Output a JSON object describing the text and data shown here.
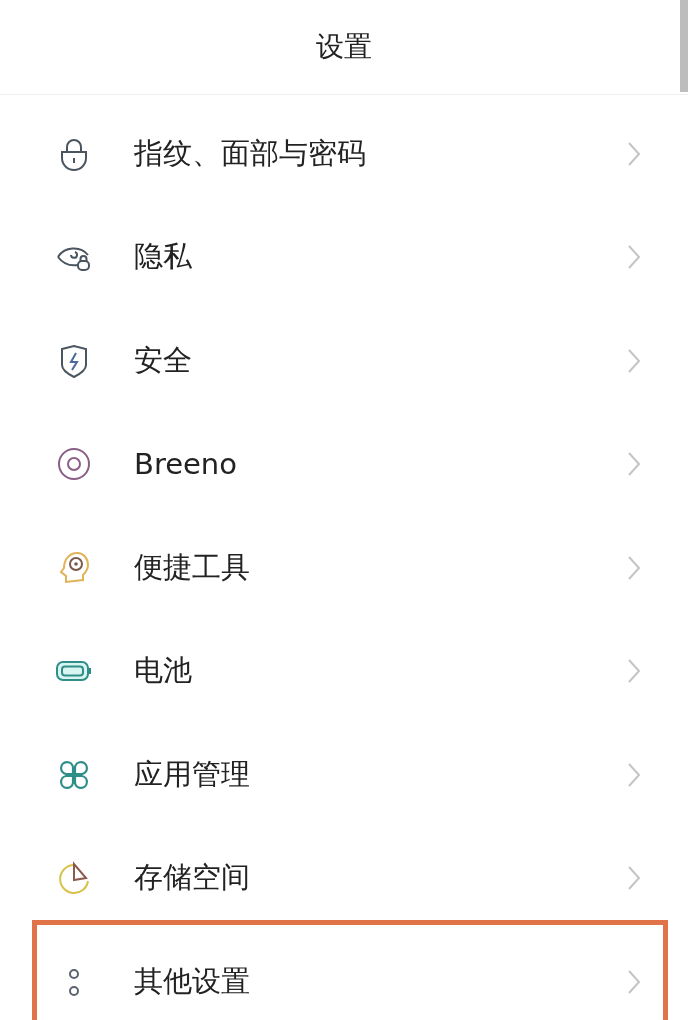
{
  "header": {
    "title": "设置"
  },
  "items": [
    {
      "label": "指纹、面部与密码",
      "highlighted": false
    },
    {
      "label": "隐私",
      "highlighted": false
    },
    {
      "label": "安全",
      "highlighted": false
    },
    {
      "label": "Breeno",
      "highlighted": false
    },
    {
      "label": "便捷工具",
      "highlighted": false
    },
    {
      "label": "电池",
      "highlighted": false
    },
    {
      "label": "应用管理",
      "highlighted": false
    },
    {
      "label": "存储空间",
      "highlighted": false
    },
    {
      "label": "其他设置",
      "highlighted": true
    }
  ]
}
